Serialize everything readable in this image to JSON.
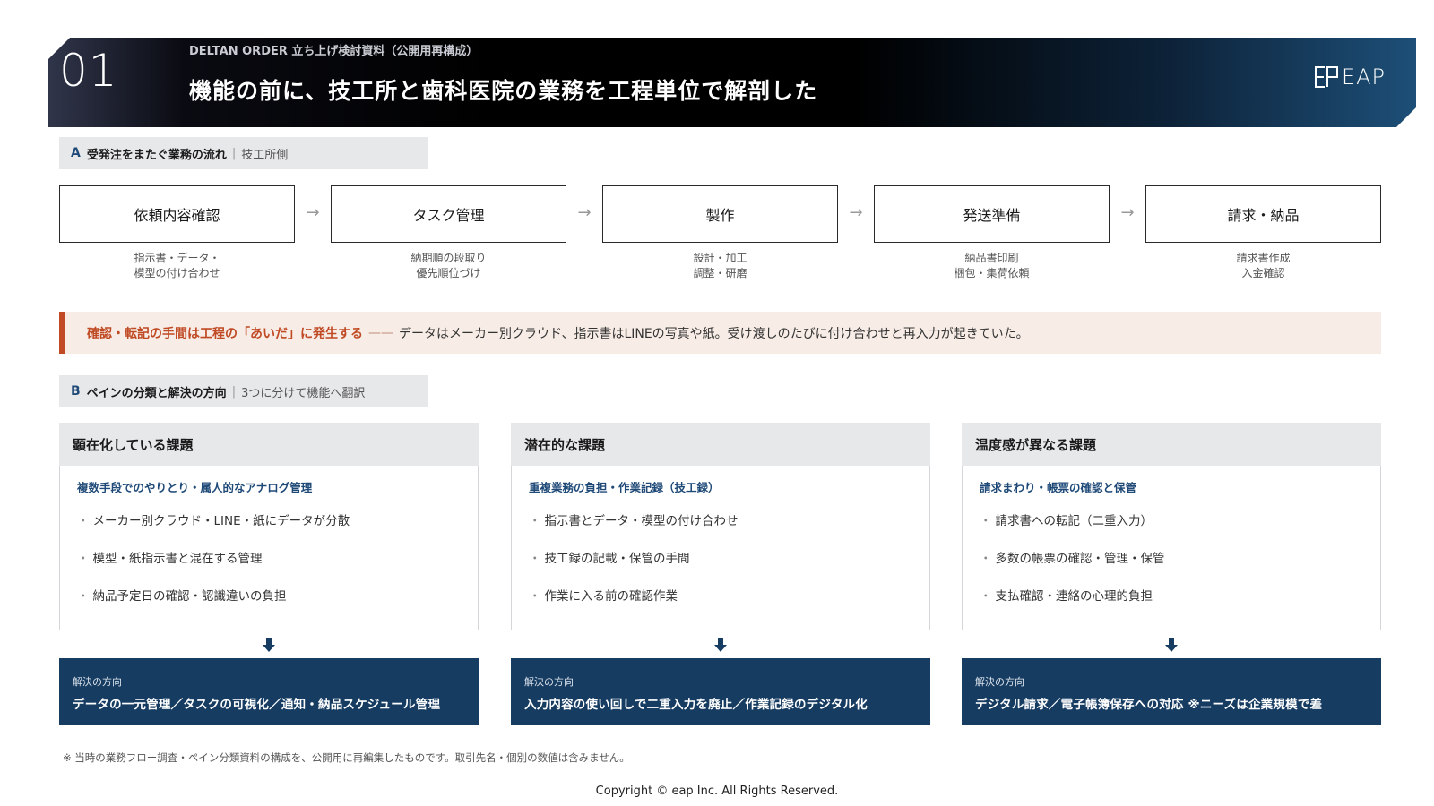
{
  "header": {
    "number": "01",
    "subtitle": "DELTAN ORDER 立ち上げ検討資料（公開用再構成）",
    "title": "機能の前に、技工所と歯科医院の業務を工程単位で解剖した",
    "logo_text": "EAP"
  },
  "section_a": {
    "letter": "A",
    "title": "受発注をまたぐ業務の流れ",
    "separator": "|",
    "sub": "技工所側",
    "arrow": "→",
    "steps": [
      {
        "label": "依頼内容確認",
        "desc1": "指示書・データ・",
        "desc2": "模型の付け合わせ"
      },
      {
        "label": "タスク管理",
        "desc1": "納期順の段取り",
        "desc2": "優先順位づけ"
      },
      {
        "label": "製作",
        "desc1": "設計・加工",
        "desc2": "調整・研磨"
      },
      {
        "label": "発送準備",
        "desc1": "納品書印刷",
        "desc2": "梱包・集荷依頼"
      },
      {
        "label": "請求・納品",
        "desc1": "請求書作成",
        "desc2": "入金確認"
      }
    ]
  },
  "callout": {
    "strong": "確認・転記の手間は工程の「あいだ」に発生する",
    "dash": "——",
    "text": "データはメーカー別クラウド、指示書はLINEの写真や紙。受け渡しのたびに付け合わせと再入力が起きていた。"
  },
  "section_b": {
    "letter": "B",
    "title": "ペインの分類と解決の方向",
    "separator": "|",
    "sub": "3つに分けて機能へ翻訳",
    "columns": [
      {
        "head": "顕在化している課題",
        "sub": "複数手段でのやりとり・属人的なアナログ管理",
        "items": [
          "メーカー別クラウド・LINE・紙にデータが分散",
          "模型・紙指示書と混在する管理",
          "納品予定日の確認・認識違いの負担"
        ],
        "sol_label": "解決の方向",
        "sol_text": "データの一元管理／タスクの可視化／通知・納品スケジュール管理"
      },
      {
        "head": "潜在的な課題",
        "sub": "重複業務の負担・作業記録（技工録）",
        "items": [
          "指示書とデータ・模型の付け合わせ",
          "技工録の記載・保管の手間",
          "作業に入る前の確認作業"
        ],
        "sol_label": "解決の方向",
        "sol_text": "入力内容の使い回しで二重入力を廃止／作業記録のデジタル化"
      },
      {
        "head": "温度感が異なる課題",
        "sub": "請求まわり・帳票の確認と保管",
        "items": [
          "請求書への転記（二重入力）",
          "多数の帳票の確認・管理・保管",
          "支払確認・連絡の心理的負担"
        ],
        "sol_label": "解決の方向",
        "sol_text": "デジタル請求／電子帳簿保存への対応 ※ニーズは企業規模で差"
      }
    ],
    "bullet": "・"
  },
  "footer": {
    "note": "※ 当時の業務フロー調査・ペイン分類資料の構成を、公開用に再編集したものです。取引先名・個別の数値は含みません。",
    "copyright": "Copyright © eap Inc. All Rights Reserved."
  },
  "colors": {
    "accent_blue": "#1f4a78",
    "solution_navy": "#163c62",
    "callout_red": "#c04a24",
    "callout_bg": "#f7ece6"
  }
}
